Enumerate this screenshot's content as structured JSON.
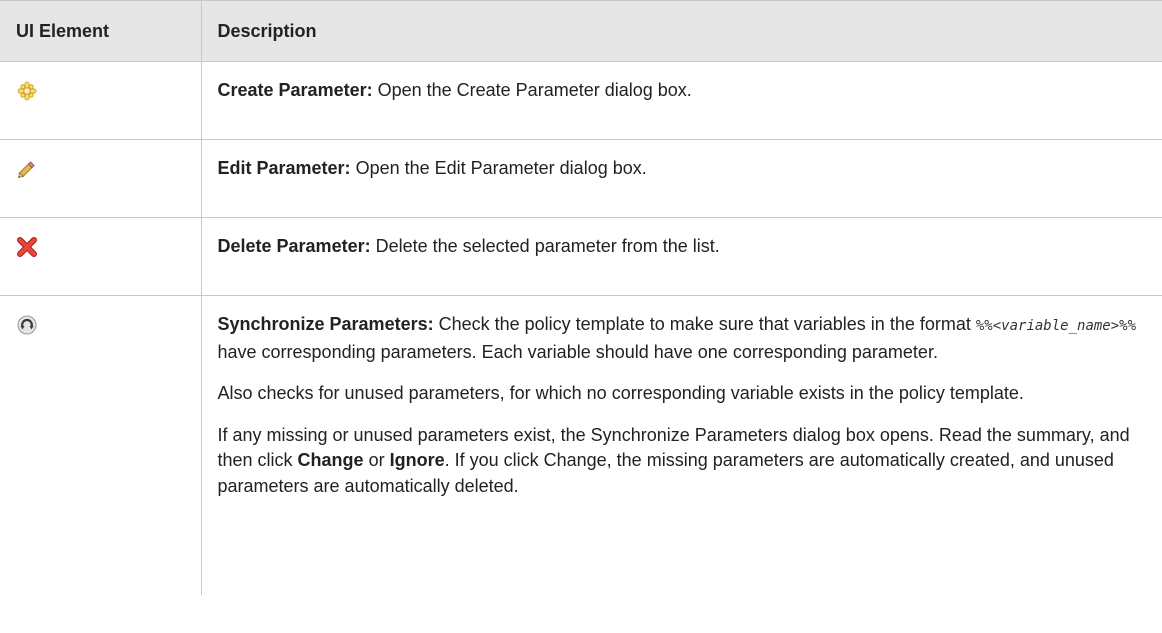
{
  "table": {
    "headers": [
      "UI Element",
      "Description"
    ],
    "rows": [
      {
        "icon": "create-star-icon",
        "term": "Create Parameter:",
        "text": " Open the Create Parameter dialog box."
      },
      {
        "icon": "edit-pencil-icon",
        "term": "Edit Parameter:",
        "text": " Open the Edit Parameter dialog box."
      },
      {
        "icon": "delete-x-icon",
        "term": "Delete Parameter:",
        "text": " Delete the selected parameter from the list."
      },
      {
        "icon": "synchronize-icon",
        "term": "Synchronize Parameters:",
        "p1_before": " Check the policy template to make sure that variables in the format ",
        "p1_code_prefix": "%%<",
        "p1_code_var": "variable_name",
        "p1_code_suffix": ">%%",
        "p1_after": " have corresponding parameters. Each variable should have one corresponding parameter.",
        "p2": "Also checks for unused parameters, for which no corresponding variable exists in the policy template.",
        "p3_before": "If any missing or unused parameters exist, the Synchronize Parameters dialog box opens. Read the summary, and then click ",
        "p3_change": "Change",
        "p3_or": " or ",
        "p3_ignore": "Ignore",
        "p3_after": ". If you click Change, the missing parameters are automatically created, and unused parameters are automatically deleted."
      }
    ]
  },
  "colors": {
    "header_bg": "#e6e6e6",
    "border": "#c8c8c8",
    "star_fill": "#f2d06b",
    "delete_red": "#d9372b"
  }
}
